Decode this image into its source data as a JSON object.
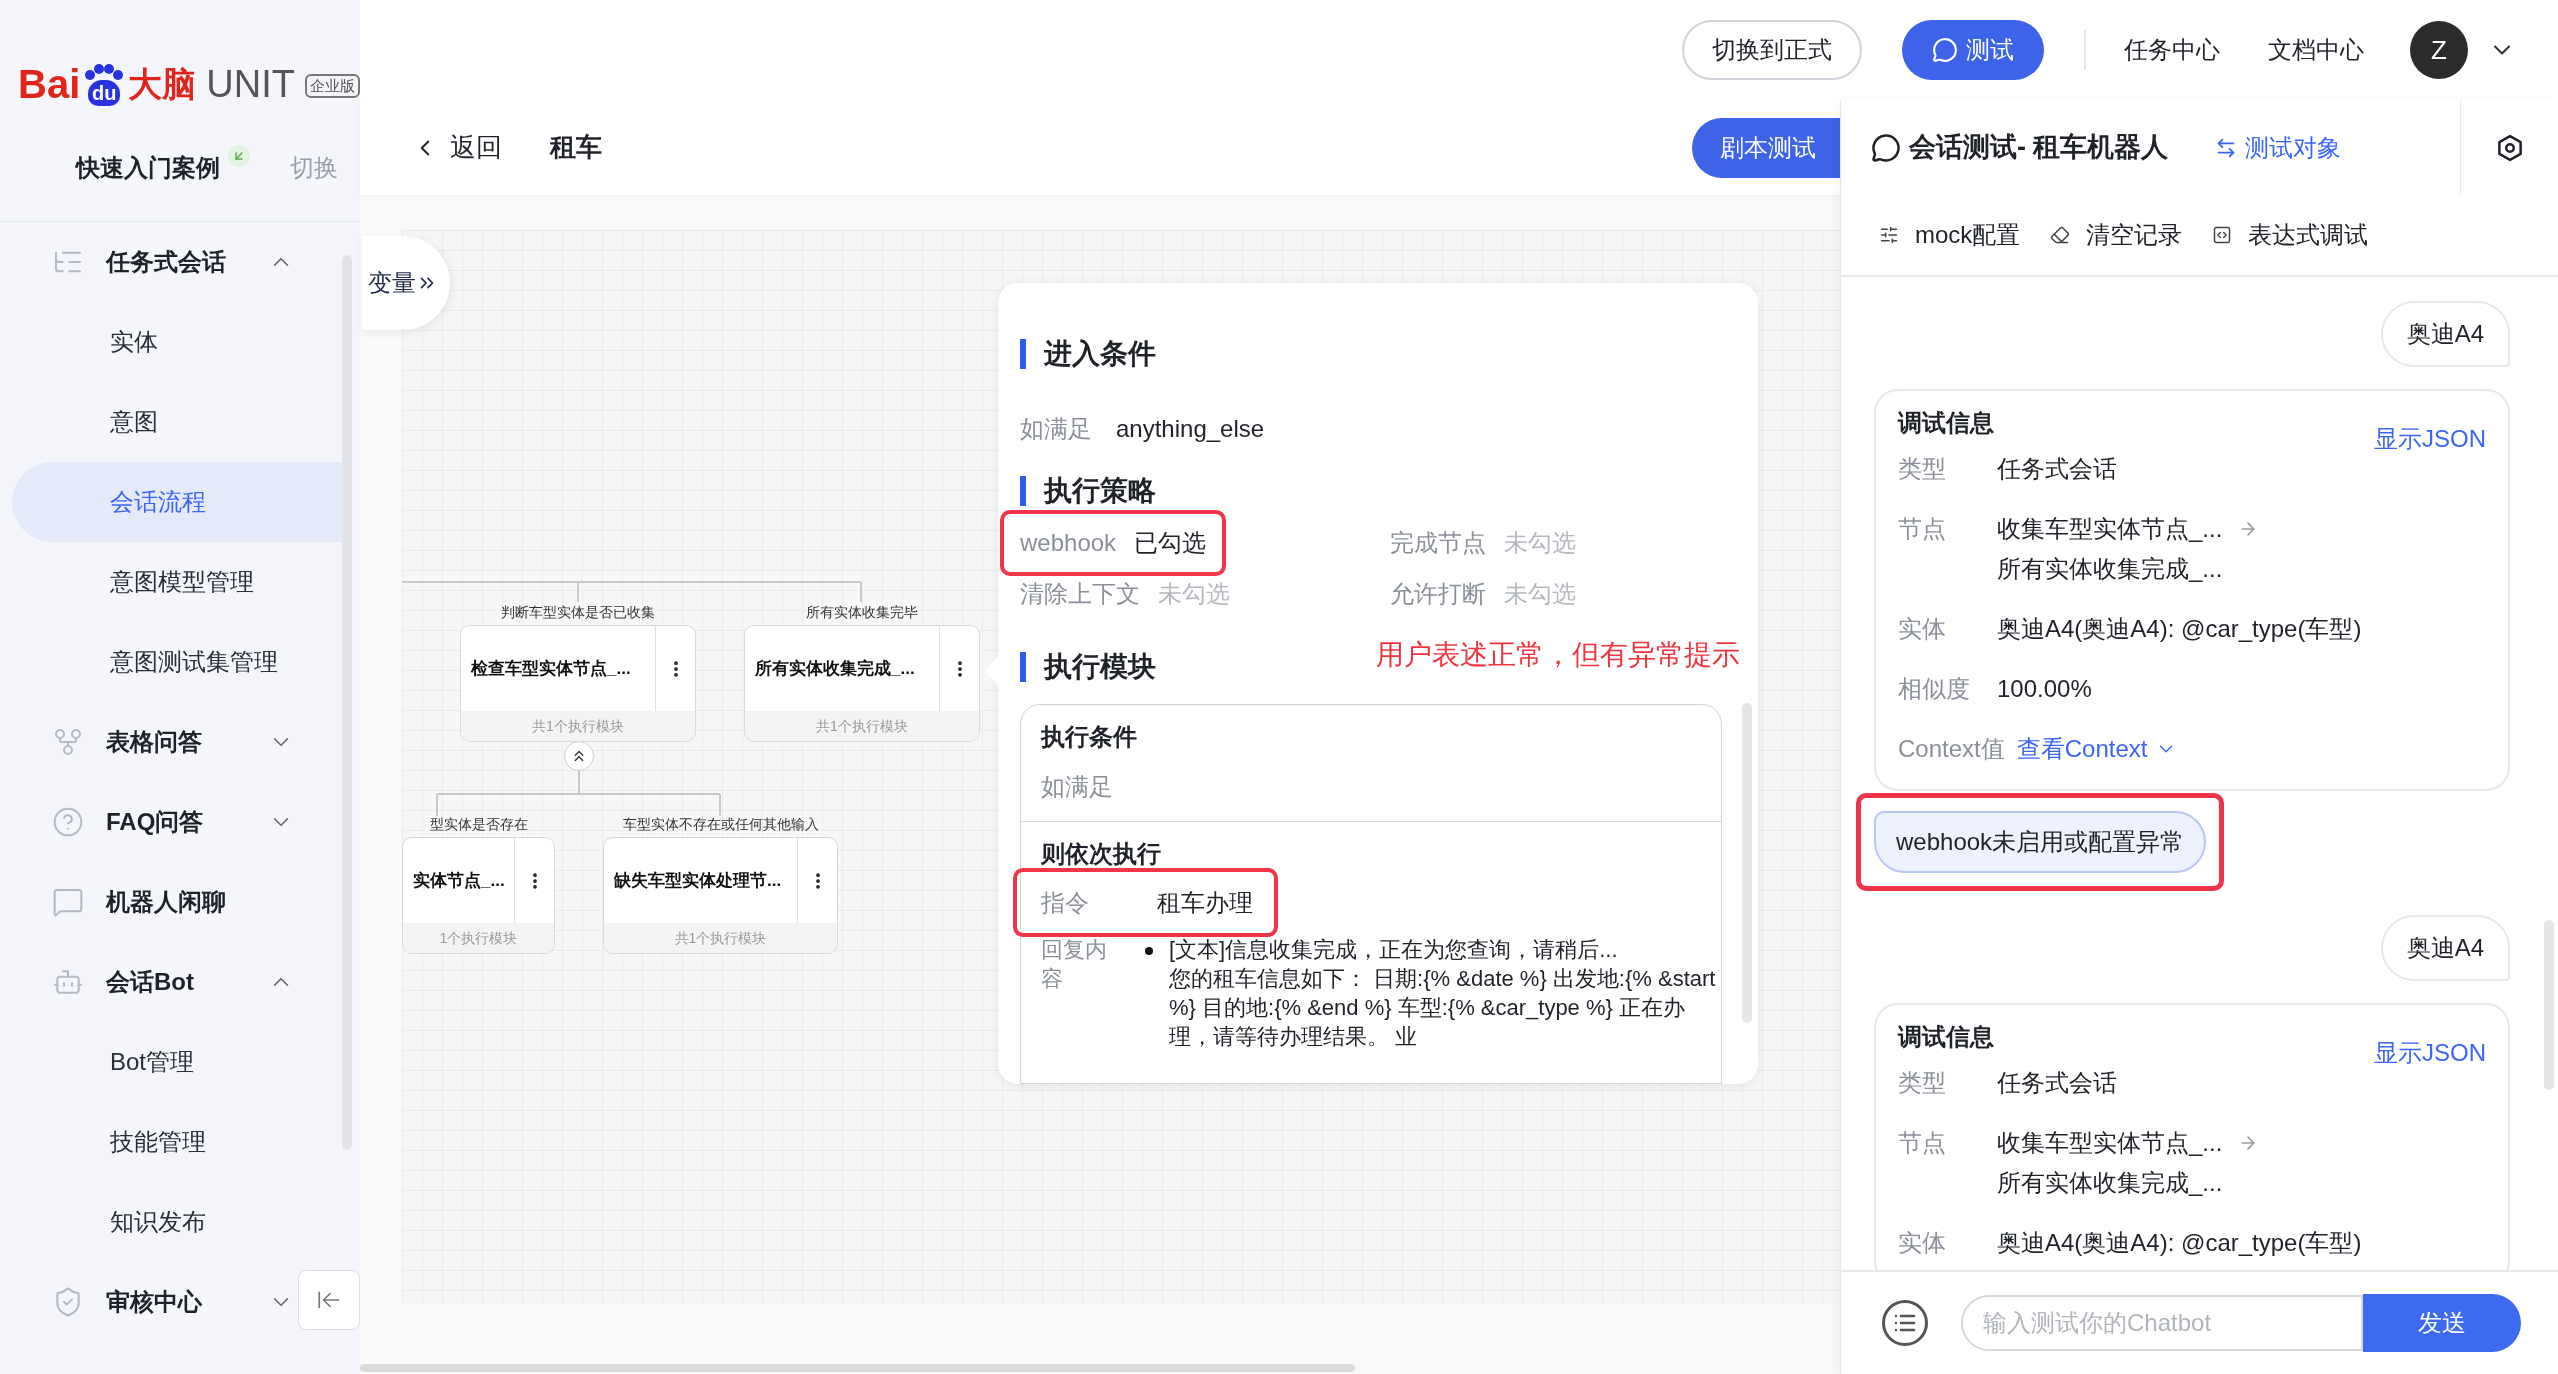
{
  "sidebar": {
    "logo": {
      "brand": "Bai",
      "paw": "du",
      "brand_cn": "大脑",
      "product": "UNIT",
      "edition": "企业版"
    },
    "case": {
      "label": "快速入门案例",
      "switch": "切换"
    },
    "menu": [
      {
        "label": "任务式会话",
        "expanded": true,
        "children": [
          {
            "label": "实体",
            "selected": false
          },
          {
            "label": "意图",
            "selected": false
          },
          {
            "label": "会话流程",
            "selected": true
          },
          {
            "label": "意图模型管理",
            "selected": false
          },
          {
            "label": "意图测试集管理",
            "selected": false
          }
        ]
      },
      {
        "label": "表格问答",
        "expanded": false
      },
      {
        "label": "FAQ问答",
        "expanded": false
      },
      {
        "label": "机器人闲聊"
      },
      {
        "label": "会话Bot",
        "expanded": true,
        "children": [
          {
            "label": "Bot管理",
            "selected": false
          },
          {
            "label": "技能管理",
            "selected": false
          },
          {
            "label": "知识发布",
            "selected": false
          }
        ]
      },
      {
        "label": "审核中心",
        "expanded": false
      }
    ]
  },
  "topbar": {
    "switch_button": "切换到正式",
    "test_button": "测试",
    "links": [
      "任务中心",
      "文档中心"
    ],
    "avatar": "Z"
  },
  "subheader": {
    "back": "返回",
    "title": "租车",
    "script_test": "剧本测试"
  },
  "canvas": {
    "variables_tab": "变量",
    "nodes": [
      {
        "condition": "判断车型实体是否已收集",
        "title": "检查车型实体节点_...",
        "footer": "共1个执行模块"
      },
      {
        "condition": "所有实体收集完毕",
        "title": "所有实体收集完成_...",
        "footer": "共1个执行模块"
      },
      {
        "condition": "型实体是否存在",
        "title": "实体节点_...",
        "footer": "1个执行模块"
      },
      {
        "condition": "车型实体不存在或任何其他输入",
        "title": "缺失车型实体处理节...",
        "footer": "共1个执行模块"
      }
    ]
  },
  "node_panel": {
    "entry": {
      "heading": "进入条件",
      "label": "如满足",
      "value": "anything_else"
    },
    "strategy": {
      "heading": "执行策略",
      "options": [
        {
          "label": "webhook",
          "value": "已勾选",
          "checked": true,
          "highlighted": true
        },
        {
          "label": "完成节点",
          "value": "未勾选",
          "checked": false,
          "highlighted": false
        },
        {
          "label": "清除上下文",
          "value": "未勾选",
          "checked": false,
          "highlighted": false
        },
        {
          "label": "允许打断",
          "value": "未勾选",
          "checked": false,
          "highlighted": false
        }
      ]
    },
    "module": {
      "heading": "执行模块",
      "condition_title": "执行条件",
      "condition_label": "如满足",
      "then_title": "则依次执行",
      "command": {
        "label": "指令",
        "value": "租车办理",
        "highlighted": true
      },
      "reply_label": "回复内容",
      "reply_lines": [
        "[文本]信息收集完成，正在为您查询，请稍后...",
        "您的租车信息如下： 日期:{% &date %} 出发地:{% &start %} 目的地:{% &end %} 车型:{% &car_type %} 正在办理，请等待办理结果。 业"
      ]
    }
  },
  "annotation": "用户表述正常，但有异常提示",
  "test_panel": {
    "title": "会话测试- 租车机器人",
    "target": "测试对象",
    "tools": [
      "mock配置",
      "清空记录",
      "表达式调试"
    ],
    "messages": [
      {
        "kind": "user",
        "text": "奥迪A4"
      },
      {
        "kind": "debug",
        "title": "调试信息",
        "json_link": "显示JSON",
        "rows": [
          {
            "kind": "text",
            "label": "类型",
            "values": [
              "任务式会话"
            ]
          },
          {
            "kind": "path",
            "label": "节点",
            "values": [
              "收集车型实体节点_...",
              "所有实体收集完成_..."
            ]
          },
          {
            "kind": "text",
            "label": "实体",
            "values": [
              "奥迪A4(奥迪A4): @car_type(车型)"
            ]
          },
          {
            "kind": "text",
            "label": "相似度",
            "values": [
              "100.00%"
            ]
          },
          {
            "kind": "link",
            "label": "Context值",
            "values": [
              "查看Context"
            ]
          }
        ]
      },
      {
        "kind": "bot",
        "text": "webhook未启用或配置异常",
        "highlighted": true
      },
      {
        "kind": "user",
        "text": "奥迪A4"
      },
      {
        "kind": "debug",
        "title": "调试信息",
        "json_link": "显示JSON",
        "rows": [
          {
            "kind": "text",
            "label": "类型",
            "values": [
              "任务式会话"
            ]
          },
          {
            "kind": "path",
            "label": "节点",
            "values": [
              "收集车型实体节点_...",
              "所有实体收集完成_..."
            ]
          },
          {
            "kind": "text",
            "label": "实体",
            "values": [
              "奥迪A4(奥迪A4): @car_type(车型)"
            ]
          }
        ]
      }
    ],
    "input": {
      "placeholder": "输入测试你的Chatbot"
    },
    "send": "发送"
  }
}
